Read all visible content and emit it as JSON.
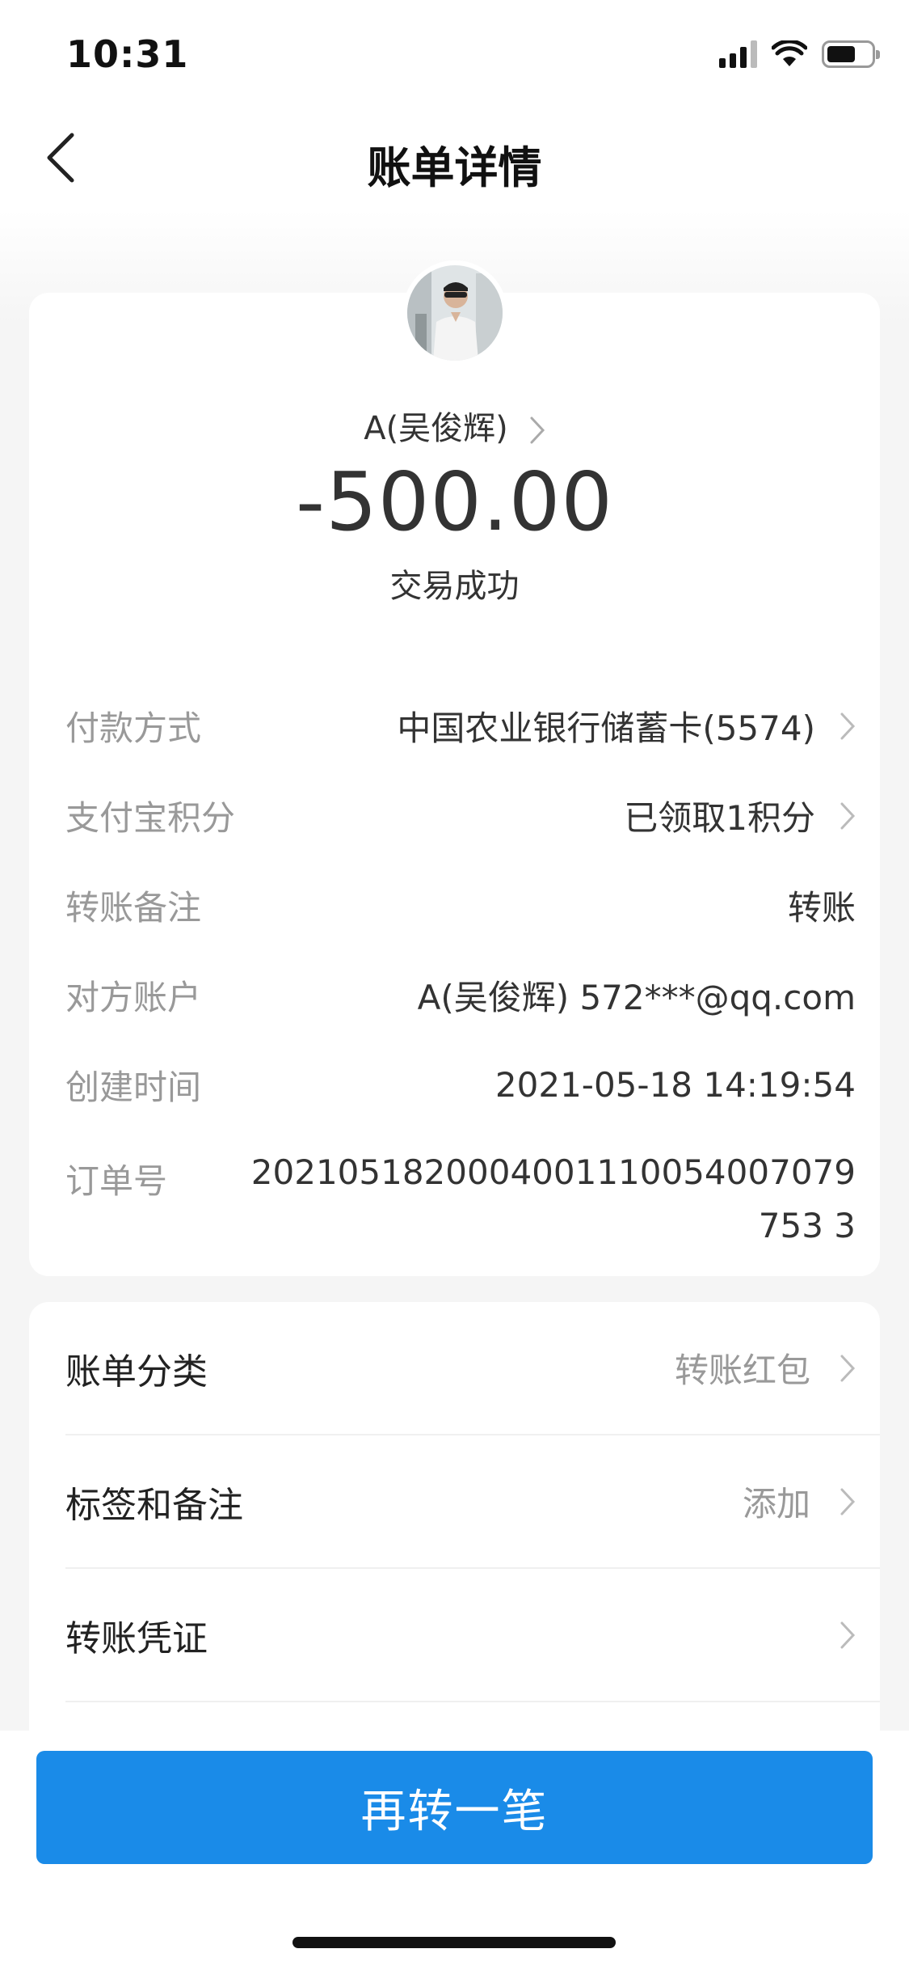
{
  "status_bar": {
    "time": "10:31"
  },
  "nav": {
    "title": "账单详情"
  },
  "summary": {
    "payee": "A(吴俊辉)",
    "amount": "-500.00",
    "status": "交易成功"
  },
  "details": {
    "payment_method": {
      "label": "付款方式",
      "value": "中国农业银行储蓄卡(5574)"
    },
    "points": {
      "label": "支付宝积分",
      "value": "已领取1积分"
    },
    "remark": {
      "label": "转账备注",
      "value": "转账"
    },
    "counterparty": {
      "label": "对方账户",
      "value": "A(吴俊辉) 572***@qq.com"
    },
    "created": {
      "label": "创建时间",
      "value": "2021-05-18 14:19:54"
    },
    "order_no": {
      "label": "订单号",
      "value": "2021051820004001110054007079753 3"
    }
  },
  "actions": {
    "category": {
      "label": "账单分类",
      "value": "转账红包"
    },
    "tags": {
      "label": "标签和备注",
      "value": "添加"
    },
    "voucher": {
      "label": "转账凭证",
      "value": ""
    }
  },
  "bottom": {
    "button_label": "再转一笔"
  },
  "colors": {
    "primary": "#1a8be8",
    "label_gray": "#999999",
    "text": "#333333"
  }
}
